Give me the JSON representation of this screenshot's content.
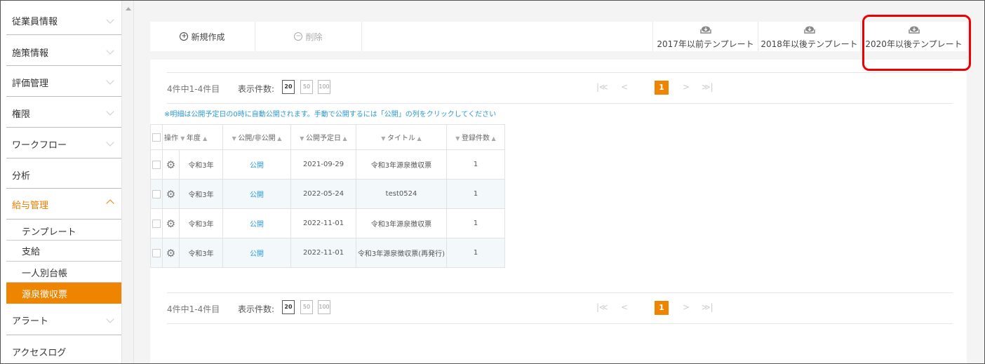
{
  "sidebar": {
    "items": [
      {
        "label": "従業員情報"
      },
      {
        "label": "施策情報"
      },
      {
        "label": "評価管理"
      },
      {
        "label": "権限"
      },
      {
        "label": "ワークフロー"
      },
      {
        "label": "分析"
      },
      {
        "label": "給与管理"
      },
      {
        "label": "アラート"
      },
      {
        "label": "アクセスログ"
      }
    ],
    "subitems": [
      {
        "label": "テンプレート"
      },
      {
        "label": "支給"
      },
      {
        "label": "一人別台帳"
      },
      {
        "label": "源泉徴収票"
      }
    ]
  },
  "toolbar": {
    "new_label": "新規作成",
    "delete_label": "削除",
    "templates": [
      {
        "label": "2017年以前テンプレート"
      },
      {
        "label": "2018年以後テンプレート"
      },
      {
        "label": "2020年以後テンプレート"
      }
    ]
  },
  "pagination": {
    "info": "4件中1-4件目",
    "count_label": "表示件数:",
    "sizes": [
      "20",
      "50",
      "100"
    ],
    "current_page": "1",
    "first": "|≪",
    "prev": "<",
    "next": ">",
    "last": "≫|"
  },
  "notice": "※明細は公開予定日の0時に自動公開されます。手動で公開するには「公開」の列をクリックしてください",
  "table": {
    "headers": {
      "op": "操作",
      "year": "年度",
      "publish": "公開/非公開",
      "date": "公開予定日",
      "title": "タイトル",
      "count": "登録件数"
    },
    "rows": [
      {
        "year": "令和3年",
        "publish": "公開",
        "date": "2021-09-29",
        "title": "令和3年源泉徴収票",
        "count": "1"
      },
      {
        "year": "令和3年",
        "publish": "公開",
        "date": "2022-05-24",
        "title": "test0524",
        "count": "1"
      },
      {
        "year": "令和3年",
        "publish": "公開",
        "date": "2022-11-01",
        "title": "令和3年源泉徴収票",
        "count": "1"
      },
      {
        "year": "令和3年",
        "publish": "公開",
        "date": "2022-11-01",
        "title": "令和3年源泉徴収票(再発行)",
        "count": "1"
      }
    ]
  },
  "colors": {
    "accent": "#ee8400",
    "link": "#2a9ad6",
    "highlight": "#e00000"
  }
}
